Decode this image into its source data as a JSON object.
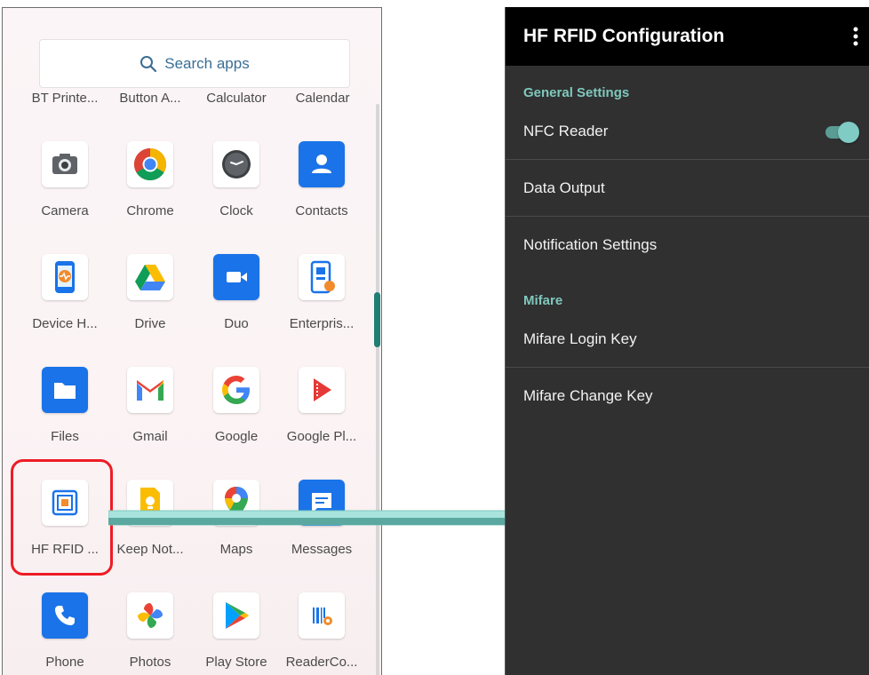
{
  "drawer": {
    "search_label": "Search apps",
    "top_row_labels": [
      "BT Printe...",
      "Button A...",
      "Calculator",
      "Calendar"
    ],
    "apps": [
      {
        "label": "Camera",
        "icon": "camera-icon"
      },
      {
        "label": "Chrome",
        "icon": "chrome-icon"
      },
      {
        "label": "Clock",
        "icon": "clock-icon"
      },
      {
        "label": "Contacts",
        "icon": "contacts-icon"
      },
      {
        "label": "Device H...",
        "icon": "device-health-icon"
      },
      {
        "label": "Drive",
        "icon": "drive-icon"
      },
      {
        "label": "Duo",
        "icon": "duo-icon"
      },
      {
        "label": "Enterpris...",
        "icon": "enterprise-icon"
      },
      {
        "label": "Files",
        "icon": "files-icon"
      },
      {
        "label": "Gmail",
        "icon": "gmail-icon"
      },
      {
        "label": "Google",
        "icon": "google-icon"
      },
      {
        "label": "Google Pl...",
        "icon": "google-play-movies-icon"
      },
      {
        "label": "HF RFID ...",
        "icon": "hf-rfid-icon"
      },
      {
        "label": "Keep Not...",
        "icon": "keep-notes-icon"
      },
      {
        "label": "Maps",
        "icon": "maps-icon"
      },
      {
        "label": "Messages",
        "icon": "messages-icon"
      },
      {
        "label": "Phone",
        "icon": "phone-icon"
      },
      {
        "label": "Photos",
        "icon": "photos-icon"
      },
      {
        "label": "Play Store",
        "icon": "play-store-icon"
      },
      {
        "label": "ReaderCo...",
        "icon": "reader-config-icon"
      }
    ]
  },
  "settings": {
    "title": "HF RFID Configuration",
    "categories": [
      "General Settings",
      "Mifare"
    ],
    "items": [
      {
        "label": "NFC Reader",
        "toggle": true
      },
      {
        "label": "Data Output"
      },
      {
        "label": "Notification Settings"
      },
      {
        "label": "Mifare Login Key"
      },
      {
        "label": "Mifare Change Key"
      }
    ]
  },
  "colors": {
    "highlight": "#ee1c25",
    "accent": "#7fc8bd",
    "arrow": "#8fd0cc"
  }
}
